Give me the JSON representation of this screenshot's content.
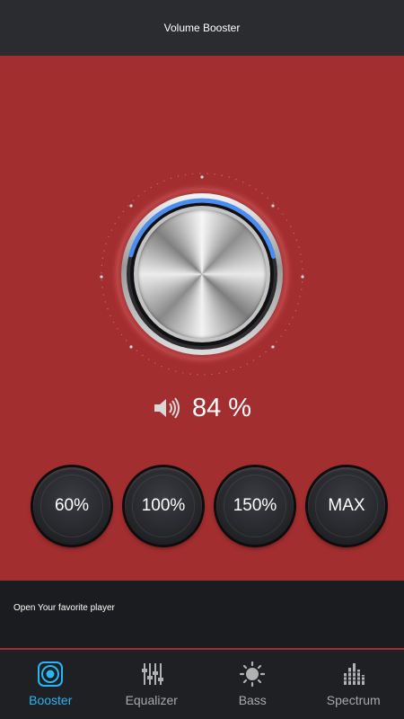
{
  "header": {
    "title": "Volume Booster"
  },
  "volume": {
    "value": 84,
    "display": "84 %"
  },
  "presets": [
    {
      "label": "60%"
    },
    {
      "label": "100%"
    },
    {
      "label": "150%"
    },
    {
      "label": "MAX"
    }
  ],
  "ad": {
    "text": "Open Your favorite player"
  },
  "tabs": [
    {
      "label": "Booster",
      "icon": "booster-icon",
      "active": true
    },
    {
      "label": "Equalizer",
      "icon": "equalizer-icon",
      "active": false
    },
    {
      "label": "Bass",
      "icon": "bass-icon",
      "active": false
    },
    {
      "label": "Spectrum",
      "icon": "spectrum-icon",
      "active": false
    }
  ],
  "colors": {
    "background": "#a22e2f",
    "accent": "#29b6f6",
    "progress_arc": "#4a8cf0",
    "topbar": "#2b2c2f",
    "tabbar": "#1f2023"
  }
}
